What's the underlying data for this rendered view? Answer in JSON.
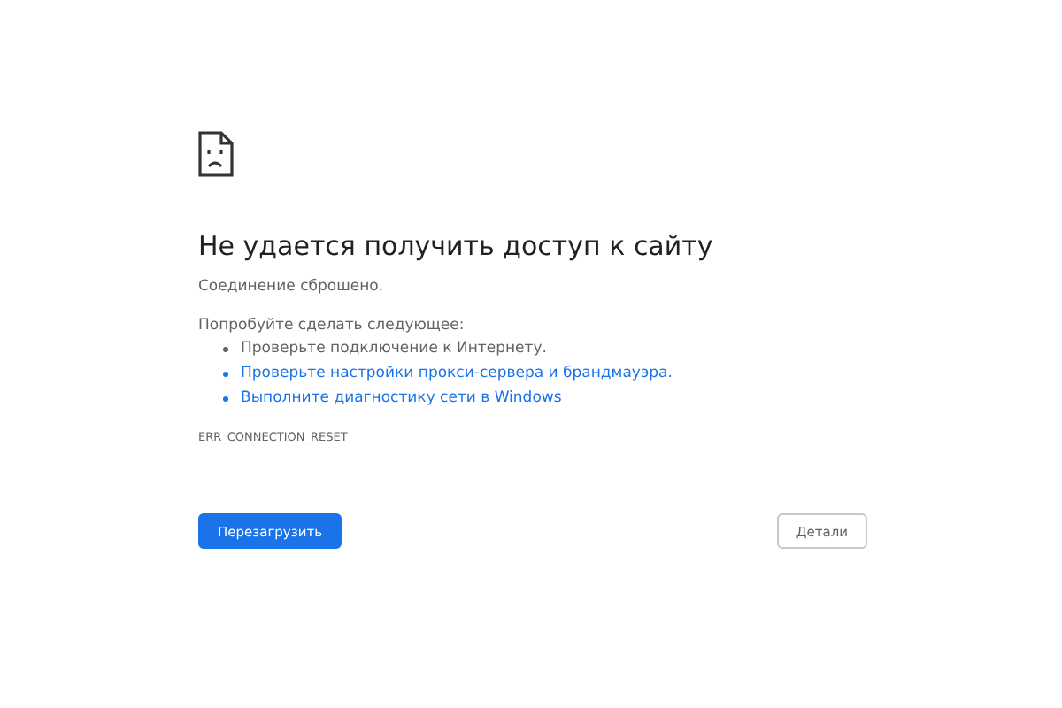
{
  "error": {
    "title": "Не удается получить доступ к сайту",
    "message": "Соединение сброшено.",
    "suggestions_heading": "Попробуйте сделать следующее:",
    "suggestions": [
      {
        "kind": "text",
        "label": "Проверьте подключение к Интернету."
      },
      {
        "kind": "link",
        "label": "Проверьте настройки прокси-сервера и брандмауэра."
      },
      {
        "kind": "link",
        "label": "Выполните диагностику сети в Windows"
      }
    ],
    "code": "ERR_CONNECTION_RESET"
  },
  "buttons": [
    {
      "kind": "primary",
      "label": "Перезагрузить"
    },
    {
      "kind": "secondary",
      "label": "Детали"
    }
  ]
}
